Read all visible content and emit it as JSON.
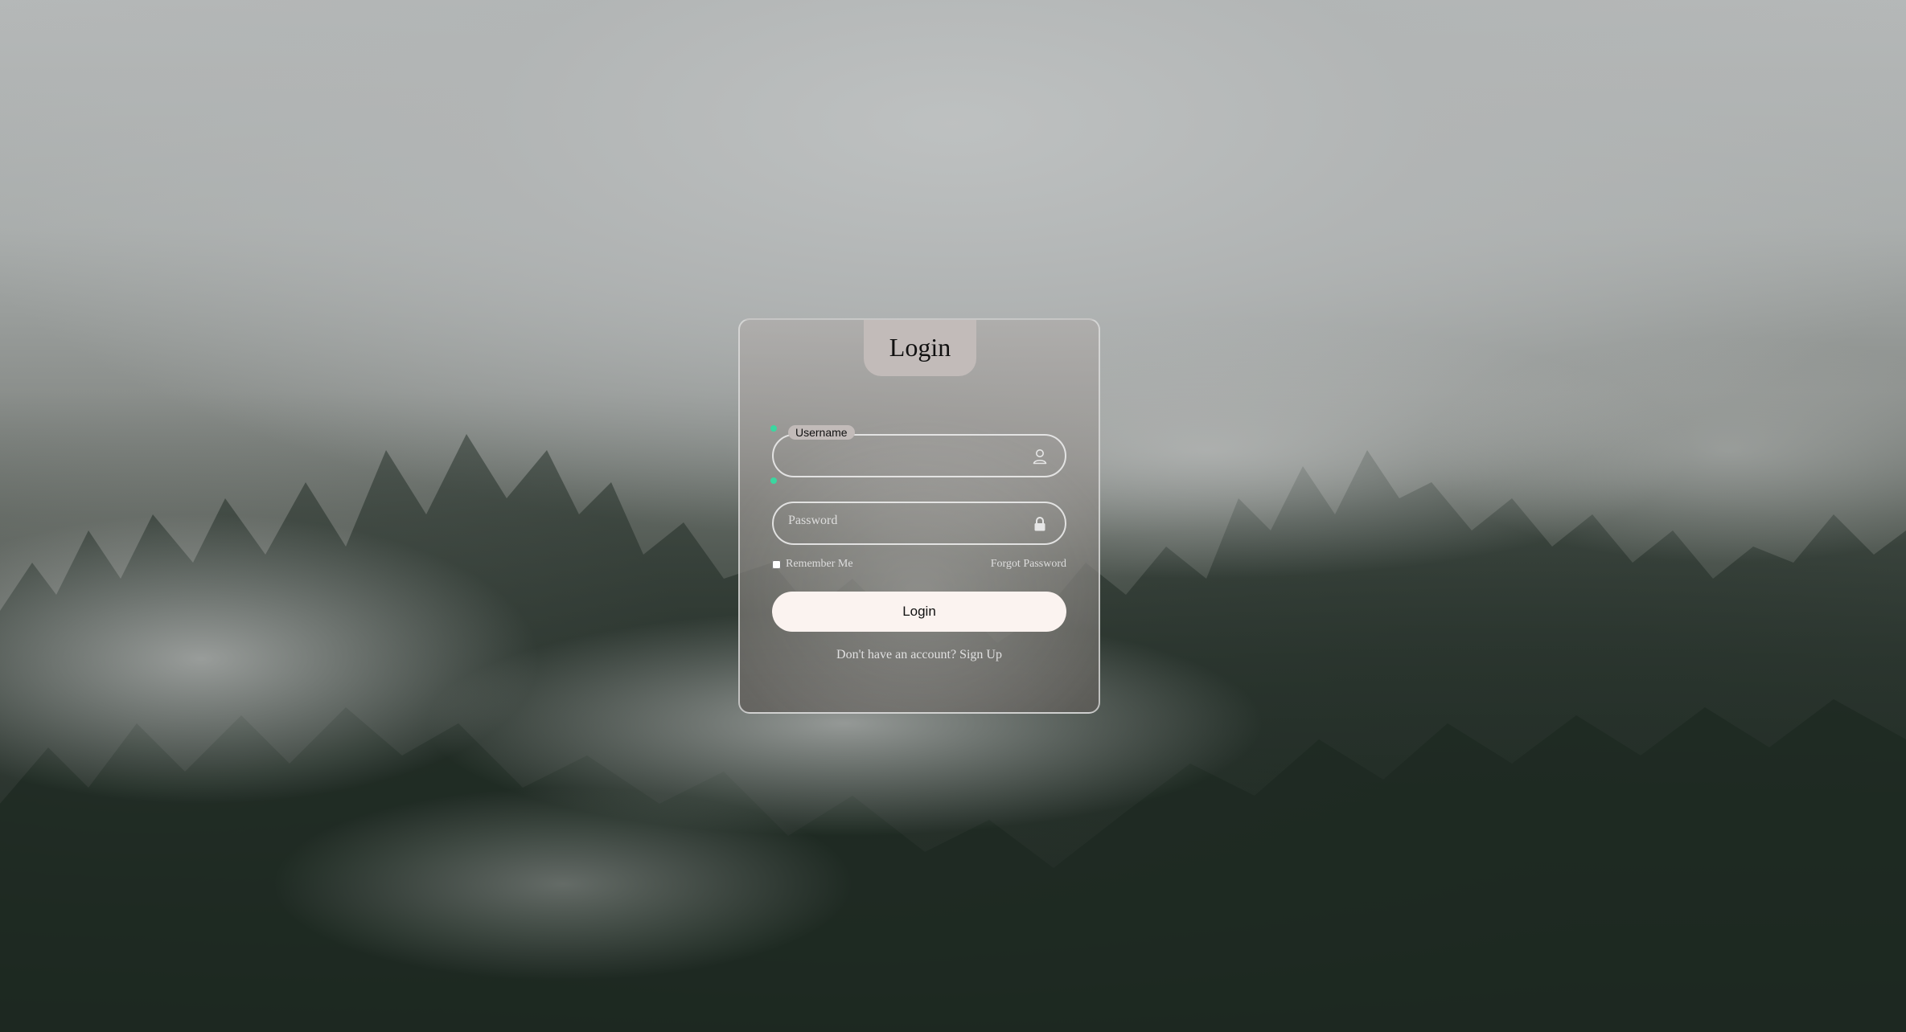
{
  "login": {
    "title": "Login",
    "username": {
      "label": "Username",
      "value": "",
      "icon": "user-icon"
    },
    "password": {
      "placeholder": "Password",
      "icon": "lock-icon"
    },
    "remember_label": "Remember Me",
    "forgot_label": "Forgot Password",
    "submit_label": "Login",
    "signup_prompt": "Don't have an account?",
    "signup_link": "Sign Up"
  },
  "colors": {
    "card_tab": "#c2bbb9",
    "button": "#fbf3f0",
    "accent_dot": "#3ad7a0"
  }
}
